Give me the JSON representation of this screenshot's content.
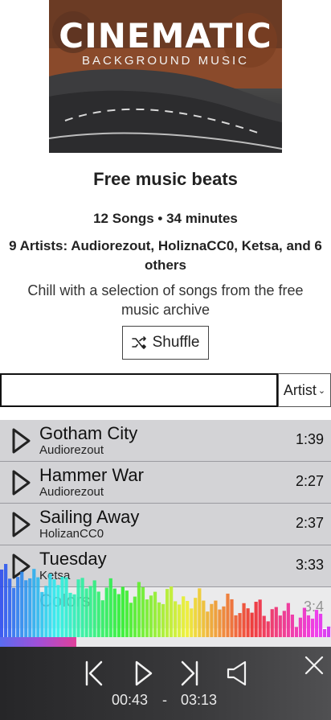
{
  "cover": {
    "title": "CINEMATIC",
    "subtitle": "BACKGROUND MUSIC"
  },
  "playlist": {
    "title": "Free music beats",
    "stats": "12 Songs • 34 minutes",
    "artists": "9 Artists: Audiorezout, HoliznaCC0, Ketsa, and 6 others",
    "description": "Chill with a selection of songs from the free music archive"
  },
  "shuffle": {
    "label": "Shuffle",
    "icon": "shuffle-icon"
  },
  "search": {
    "value": "",
    "placeholder": ""
  },
  "sort": {
    "selected": "Artist",
    "icon": "chevron-down-icon"
  },
  "tracks": [
    {
      "name": "Gotham City",
      "artist": "Audiorezout",
      "duration": "1:39"
    },
    {
      "name": "Hammer War",
      "artist": "Audiorezout",
      "duration": "2:27"
    },
    {
      "name": "Sailing Away",
      "artist": "HolizanCC0",
      "duration": "2:37"
    },
    {
      "name": "Tuesday",
      "artist": "Ketsa",
      "duration": "3:33"
    },
    {
      "name": "Colors",
      "artist": "",
      "duration": "3:4"
    }
  ],
  "player": {
    "current_time": "00:43",
    "separator": "-",
    "total_time": "03:13",
    "progress_fraction": 0.23,
    "icons": [
      "previous-icon",
      "play-icon",
      "next-icon",
      "volume-icon",
      "close-icon"
    ]
  },
  "colors": {
    "track_bg": "#d3d3d6",
    "player_bg": "#2e2e30",
    "progress_accent": "#e0409a"
  }
}
